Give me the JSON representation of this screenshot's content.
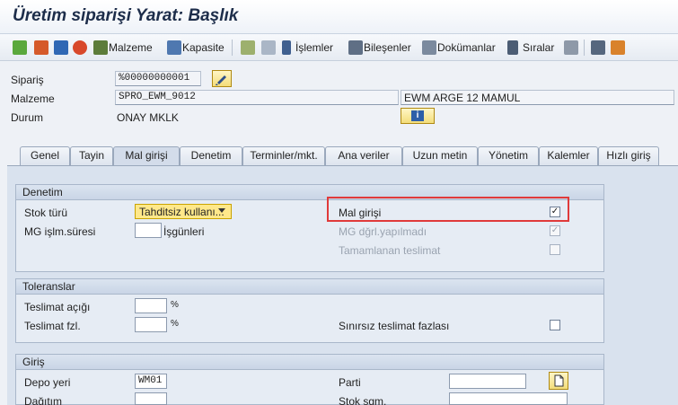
{
  "title": "Üretim siparişi Yarat: Başlık",
  "toolbar": {
    "malzeme": "Malzeme",
    "kapasite": "Kapasite",
    "islemler": "İşlemler",
    "bilesenler": "Bileşenler",
    "dokumanlar": "Dokümanlar",
    "siralar": "Sıralar"
  },
  "header": {
    "siparis_label": "Sipariş",
    "siparis_value": "%00000000001",
    "malzeme_label": "Malzeme",
    "malzeme_value": "SPRO_EWM_9012",
    "malzeme_desc": "EWM ARGE 12 MAMUL",
    "durum_label": "Durum",
    "durum_value": "ONAY MKLK"
  },
  "tabs": [
    "Genel",
    "Tayin",
    "Mal girişi",
    "Denetim",
    "Terminler/mkt.",
    "Ana veriler",
    "Uzun metin",
    "Yönetim",
    "Kalemler",
    "Hızlı giriş"
  ],
  "denetim": {
    "title": "Denetim",
    "stok_turu_label": "Stok türü",
    "stok_turu_value": "Tahditsiz kullanı...",
    "mg_islm_label": "MG işlm.süresi",
    "mg_islm_unit": "İşgünleri",
    "mal_girisi_label": "Mal girişi",
    "mg_dgrl_label": "MG dğrl.yapılmadı",
    "tamamlanan_label": "Tamamlanan teslimat"
  },
  "toleranslar": {
    "title": "Toleranslar",
    "teslimat_acigi_label": "Teslimat açığı",
    "teslimat_fzl_label": "Teslimat fzl.",
    "percent": "%",
    "sinirsiz_label": "Sınırsız teslimat fazlası"
  },
  "giris": {
    "title": "Giriş",
    "depo_label": "Depo yeri",
    "depo_value": "WM01",
    "dagitim_label": "Dağıtım",
    "parti_label": "Parti",
    "stok_sgm_label": "Stok sgm."
  },
  "colors": {
    "highlight": "#e03a3a",
    "dropdown": "#ffe88a"
  }
}
